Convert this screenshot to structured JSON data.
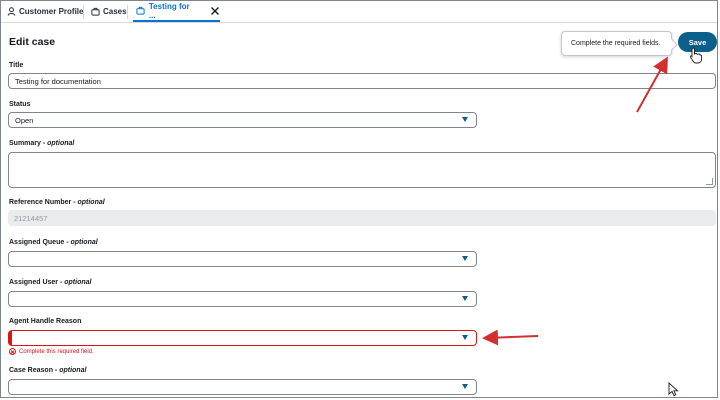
{
  "tabs": [
    {
      "label": "Customer Profile",
      "icon": "person-icon"
    },
    {
      "label": "Cases",
      "icon": "briefcase-icon"
    },
    {
      "label": "Testing for ...",
      "icon": "briefcase-icon",
      "active": true
    }
  ],
  "header": {
    "title": "Edit case",
    "tooltip": "Complete the required fields.",
    "save_label": "Save"
  },
  "fields": {
    "title": {
      "label": "Title",
      "value": "Testing for documentation"
    },
    "status": {
      "label": "Status",
      "value": "Open"
    },
    "summary": {
      "label": "Summary",
      "optional": "- optional",
      "value": ""
    },
    "reference_number": {
      "label": "Reference Number",
      "optional": "- optional",
      "value": "21214457"
    },
    "assigned_queue": {
      "label": "Assigned Queue",
      "optional": "- optional",
      "value": ""
    },
    "assigned_user": {
      "label": "Assigned User",
      "optional": "- optional",
      "value": ""
    },
    "agent_handle_reason": {
      "label": "Agent Handle Reason",
      "value": "",
      "error": "Complete this required field."
    },
    "case_reason": {
      "label": "Case Reason",
      "optional": "- optional",
      "value": ""
    }
  },
  "colors": {
    "accent": "#0b5f8a",
    "error": "#d91515",
    "annotation_arrow": "#d32f2f"
  }
}
